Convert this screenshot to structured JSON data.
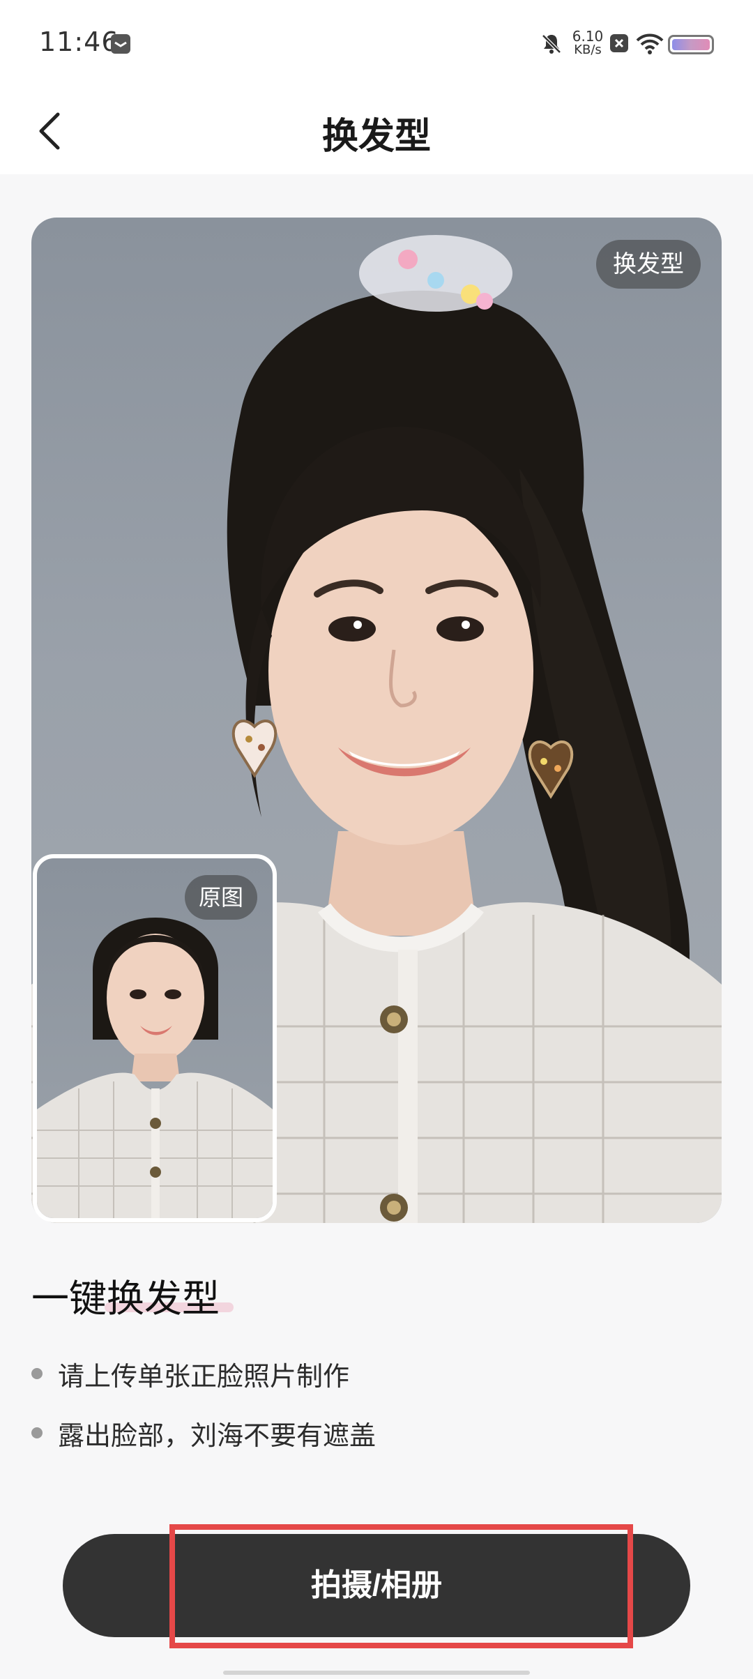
{
  "status_bar": {
    "time": "11:46",
    "net_speed_value": "6.10",
    "net_speed_unit": "KB/s",
    "icons": [
      "message-icon",
      "mute-bell-icon",
      "close-box-icon",
      "wifi-icon",
      "battery-icon"
    ]
  },
  "header": {
    "title": "换发型",
    "back_icon": "chevron-left-icon"
  },
  "preview": {
    "result_tag": "换发型",
    "original_tag": "原图"
  },
  "feature": {
    "title": "一键换发型",
    "tips": [
      "请上传单张正脸照片制作",
      "露出脸部，刘海不要有遮盖"
    ]
  },
  "action": {
    "label": "拍摄/相册"
  },
  "colors": {
    "button_bg": "#333333",
    "highlight": "#e54848",
    "page_bg": "#f7f7f8"
  }
}
